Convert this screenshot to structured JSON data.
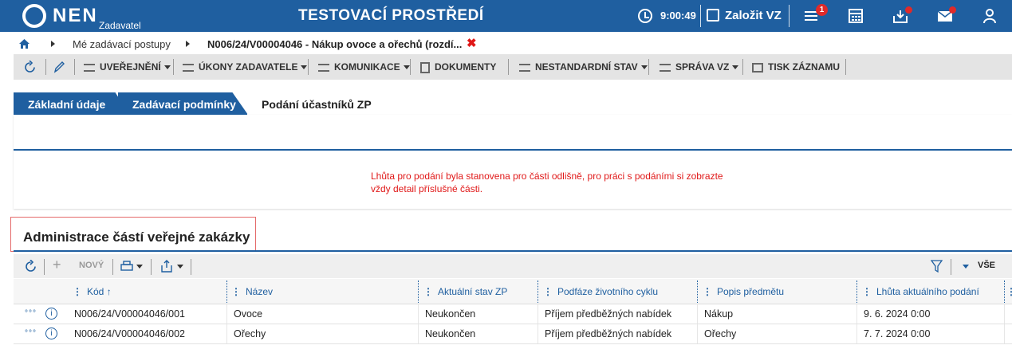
{
  "header": {
    "logo": "NEN",
    "logo_sub": "Zadavatel",
    "environment": "TESTOVACÍ PROSTŘEDÍ",
    "time": "9:00:49",
    "create_label": "Založit VZ",
    "notification_count": "1"
  },
  "breadcrumb": {
    "items": [
      "Mé zadávací postupy",
      "N006/24/V00004046 - Nákup ovoce a ořechů (rozdí..."
    ]
  },
  "toolbar": {
    "uverejneni": "UVEŘEJNĚNÍ",
    "ukony": "ÚKONY ZADAVATELE",
    "komunikace": "KOMUNIKACE",
    "dokumenty": "DOKUMENTY",
    "nestandardni": "NESTANDARDNÍ STAV",
    "sprava": "SPRÁVA VZ",
    "tisk": "TISK ZÁZNAMU"
  },
  "tabs": [
    "Základní údaje",
    "Zadávací podmínky",
    "Podání účastníků ZP"
  ],
  "notice": "Lhůta pro podání byla stanovena pro části odlišně, pro práci s podáními si zobrazte vždy detail příslušné části.",
  "section": {
    "title": "Administrace částí veřejné zakázky",
    "new_label": "NOVÝ",
    "filter_all": "VŠE"
  },
  "grid": {
    "columns": [
      "Kód",
      "Název",
      "Aktuální stav ZP",
      "Podfáze životního cyklu",
      "Popis předmětu",
      "Lhůta aktuálního podání"
    ],
    "rows": [
      [
        "N006/24/V00004046/001",
        "Ovoce",
        "Neukončen",
        "Příjem předběžných nabídek",
        "Nákup",
        "9. 6. 2024 0:00"
      ],
      [
        "N006/24/V00004046/002",
        "Ořechy",
        "Neukončen",
        "Příjem předběžných nabídek",
        "Ořechy",
        "7. 7. 2024 0:00"
      ]
    ]
  },
  "colors": {
    "brand": "#1f5fa0",
    "alert": "#e01818",
    "badge": "#e02a2a"
  }
}
